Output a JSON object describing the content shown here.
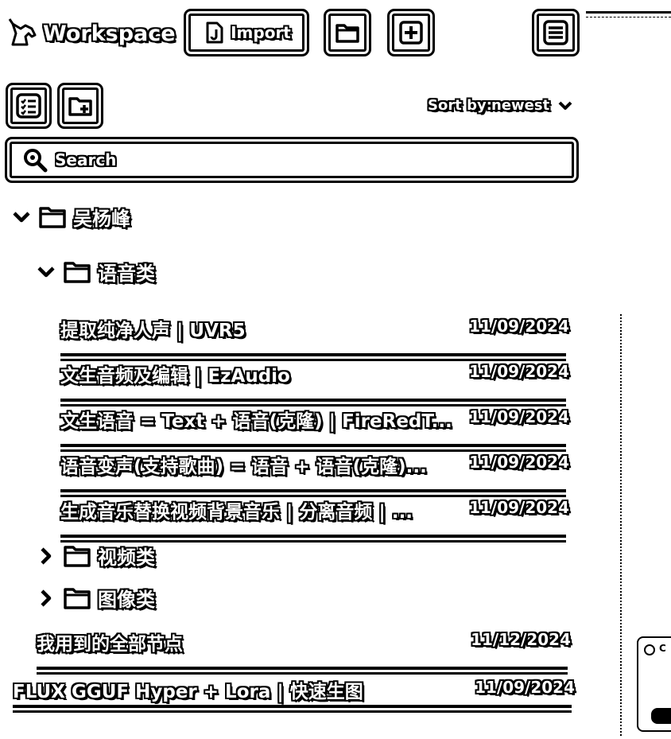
{
  "header": {
    "title": "Workspace",
    "import_label": "Import"
  },
  "toolbar": {
    "sort_label": "Sort by:",
    "sort_value": "newest"
  },
  "search": {
    "placeholder": "Search"
  },
  "tree": {
    "root_folder": {
      "name": "吴杨峰",
      "expanded": true
    },
    "sub_folders": [
      {
        "name": "语音类",
        "expanded": true
      },
      {
        "name": "视频类",
        "expanded": false
      },
      {
        "name": "图像类",
        "expanded": false
      }
    ],
    "voice_items": [
      {
        "title": "提取纯净人声 | UVR5",
        "date": "11/09/2024"
      },
      {
        "title": "文生音频及编辑 | EzAudio",
        "date": "11/09/2024"
      },
      {
        "title": "文生语音 = Text + 语音(克隆) | FireRedT...",
        "date": "11/09/2024"
      },
      {
        "title": "语音变声(支持歌曲) = 语音 + 语音(克隆)...",
        "date": "11/09/2024"
      },
      {
        "title": "生成音乐替换视频背景音乐 | 分离音频 | ...",
        "date": "11/09/2024"
      }
    ],
    "root_items": [
      {
        "title": "我用到的全部节点",
        "date": "11/12/2024"
      }
    ],
    "top_items": [
      {
        "title": "FLUX GGUF Hyper + Lora | 快速生图",
        "date": "11/09/2024"
      }
    ]
  },
  "side_card": {
    "label": "C"
  },
  "icons": [
    "unicorn-logo-icon",
    "import-file-icon",
    "folder-icon",
    "plus-icon",
    "menu-icon",
    "tasks-icon",
    "folder-add-icon",
    "chevron-down-icon",
    "search-icon",
    "chevron-right-icon"
  ]
}
